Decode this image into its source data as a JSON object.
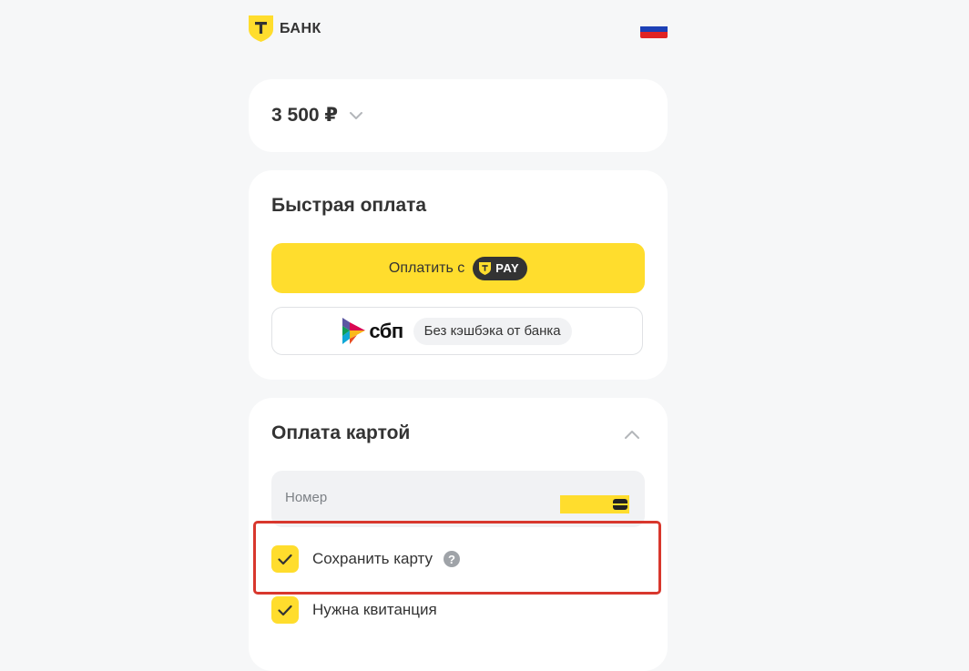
{
  "header": {
    "logo_text": "БАНК",
    "logo_icon": "t-bank-shield-icon",
    "flag_icon": "russian-flag-icon",
    "brand_color": "#ffdd2d"
  },
  "amount": {
    "value": "3 500 ₽",
    "toggle_icon": "chevron-down-icon"
  },
  "fast_payment": {
    "title": "Быстрая оплата",
    "tpay_button_label": "Оплатить с",
    "tpay_badge": "PAY",
    "sbp_logo": "сбп",
    "sbp_note": "Без кэшбэка от банка"
  },
  "card_payment": {
    "title": "Оплата картой",
    "collapse_icon": "chevron-up-icon",
    "number_placeholder": "Номер",
    "save_card_label": "Сохранить карту",
    "save_card_checked": true,
    "receipt_label": "Нужна квитанция",
    "receipt_checked": true,
    "help_glyph": "?"
  },
  "highlight_color": "#d8372d"
}
